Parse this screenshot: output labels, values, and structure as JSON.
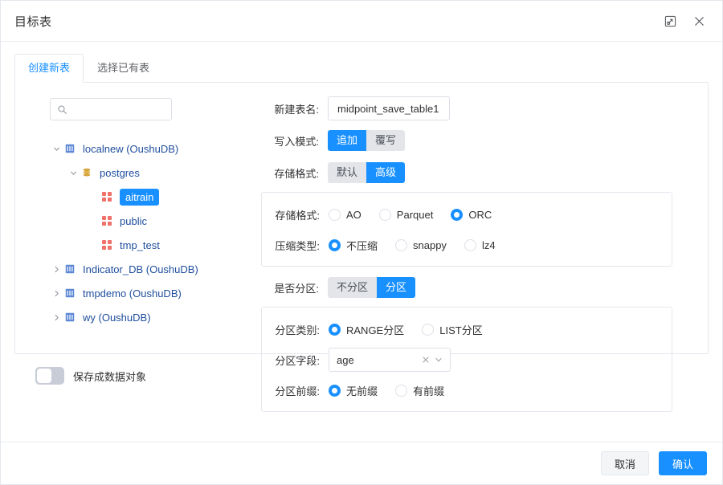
{
  "window": {
    "title": "目标表",
    "expand_icon": "expand-icon",
    "close_icon": "close-icon"
  },
  "tabs": [
    {
      "label": "创建新表",
      "active": true
    },
    {
      "label": "选择已有表",
      "active": false
    }
  ],
  "tree": {
    "search": {
      "value": "",
      "placeholder": "",
      "icon": "search-icon"
    },
    "nodes": [
      {
        "label": "localnew (OushuDB)",
        "level": 1,
        "expanded": true,
        "icon": "database-icon",
        "selected": false
      },
      {
        "label": "postgres",
        "level": 2,
        "expanded": true,
        "icon": "schema-db-icon",
        "selected": false
      },
      {
        "label": "aitrain",
        "level": 3,
        "expanded": null,
        "icon": "table-grid-icon",
        "selected": true
      },
      {
        "label": "public",
        "level": 3,
        "expanded": null,
        "icon": "table-grid-icon",
        "selected": false
      },
      {
        "label": "tmp_test",
        "level": 3,
        "expanded": null,
        "icon": "table-grid-icon",
        "selected": false
      },
      {
        "label": "Indicator_DB (OushuDB)",
        "level": 1,
        "expanded": false,
        "icon": "database-icon",
        "selected": false
      },
      {
        "label": "tmpdemo (OushuDB)",
        "level": 1,
        "expanded": false,
        "icon": "database-icon",
        "selected": false
      },
      {
        "label": "wy (OushuDB)",
        "level": 1,
        "expanded": false,
        "icon": "database-icon",
        "selected": false
      }
    ]
  },
  "form": {
    "table_name": {
      "label": "新建表名:",
      "value": "midpoint_save_table1"
    },
    "write_mode": {
      "label": "写入模式:",
      "options": [
        {
          "label": "追加",
          "active": true
        },
        {
          "label": "覆写",
          "active": false
        }
      ]
    },
    "storage_mode": {
      "label": "存储格式:",
      "options": [
        {
          "label": "默认",
          "active": false
        },
        {
          "label": "高级",
          "active": true
        }
      ]
    },
    "storage_format": {
      "label": "存储格式:",
      "options": [
        {
          "label": "AO",
          "checked": false
        },
        {
          "label": "Parquet",
          "checked": false
        },
        {
          "label": "ORC",
          "checked": true
        }
      ]
    },
    "compression": {
      "label": "压缩类型:",
      "options": [
        {
          "label": "不压缩",
          "checked": true
        },
        {
          "label": "snappy",
          "checked": false
        },
        {
          "label": "lz4",
          "checked": false
        }
      ]
    },
    "partition_toggle": {
      "label": "是否分区:",
      "options": [
        {
          "label": "不分区",
          "active": false
        },
        {
          "label": "分区",
          "active": true
        }
      ]
    },
    "partition_type": {
      "label": "分区类别:",
      "options": [
        {
          "label": "RANGE分区",
          "checked": true
        },
        {
          "label": "LIST分区",
          "checked": false
        }
      ]
    },
    "partition_field": {
      "label": "分区字段:",
      "value": "age",
      "clear_icon": "clear-icon",
      "dropdown_icon": "chevron-down-icon"
    },
    "partition_prefix": {
      "label": "分区前缀:",
      "options": [
        {
          "label": "无前缀",
          "checked": true
        },
        {
          "label": "有前缀",
          "checked": false
        }
      ]
    }
  },
  "save_as_object": {
    "label": "保存成数据对象",
    "enabled": false
  },
  "footer": {
    "cancel_label": "取消",
    "confirm_label": "确认"
  },
  "colors": {
    "accent": "#1890ff",
    "table_icon": "#f0706a",
    "db_icon": "#4a77c4",
    "schema_icon": "#d6a43a"
  }
}
